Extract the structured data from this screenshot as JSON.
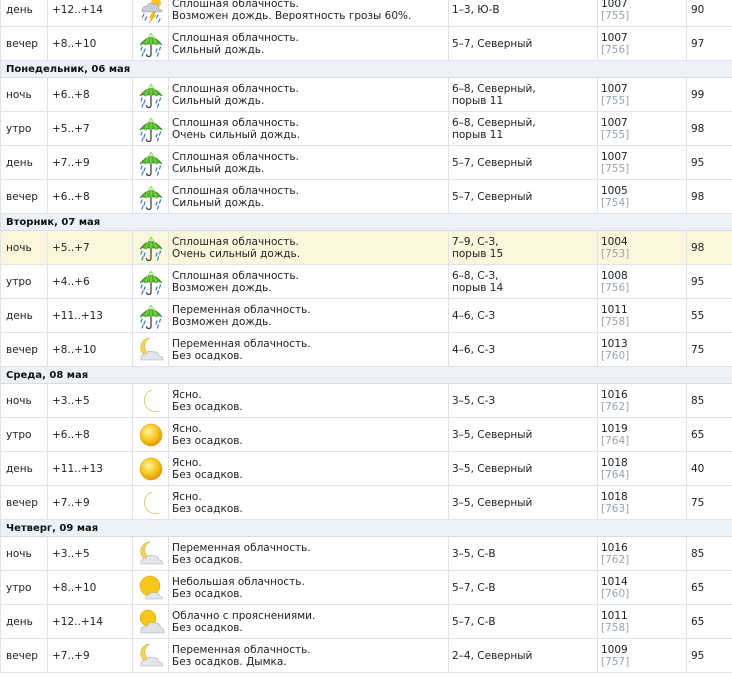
{
  "forecast": [
    {
      "rows": [
        {
          "part": "день",
          "temp": "+12..+14",
          "icon": "storm-rain-icon",
          "d1": "Сплошная облачность.",
          "d2": "Возможен дождь. Вероятность грозы 60%.",
          "w1": "1–3, Ю-В",
          "w2": "",
          "p": "1007",
          "mm": "[755]",
          "h": "90"
        },
        {
          "part": "вечер",
          "temp": "+8..+10",
          "icon": "umbrella-rain-icon",
          "d1": "Сплошная облачность.",
          "d2": "Сильный дождь.",
          "w1": "5–7, Северный",
          "w2": "",
          "p": "1007",
          "mm": "[756]",
          "h": "97"
        }
      ]
    },
    {
      "day": "Понедельник, 06 мая",
      "rows": [
        {
          "part": "ночь",
          "temp": "+6..+8",
          "icon": "umbrella-rain-icon",
          "d1": "Сплошная облачность.",
          "d2": "Сильный дождь.",
          "w1": "6–8, Северный,",
          "w2": "порыв 11",
          "p": "1007",
          "mm": "[755]",
          "h": "99"
        },
        {
          "part": "утро",
          "temp": "+5..+7",
          "icon": "umbrella-rain-icon",
          "d1": "Сплошная облачность.",
          "d2": "Очень сильный дождь.",
          "w1": "6–8, Северный,",
          "w2": "порыв 11",
          "p": "1007",
          "mm": "[755]",
          "h": "98"
        },
        {
          "part": "день",
          "temp": "+7..+9",
          "icon": "umbrella-rain-icon",
          "d1": "Сплошная облачность.",
          "d2": "Сильный дождь.",
          "w1": "5–7, Северный",
          "w2": "",
          "p": "1007",
          "mm": "[755]",
          "h": "95"
        },
        {
          "part": "вечер",
          "temp": "+6..+8",
          "icon": "umbrella-rain-icon",
          "d1": "Сплошная облачность.",
          "d2": "Сильный дождь.",
          "w1": "5–7, Северный",
          "w2": "",
          "p": "1005",
          "mm": "[754]",
          "h": "98"
        }
      ]
    },
    {
      "day": "Вторник, 07 мая",
      "rows": [
        {
          "part": "ночь",
          "temp": "+5..+7",
          "icon": "umbrella-rain-icon",
          "d1": "Сплошная облачность.",
          "d2": "Очень сильный дождь.",
          "w1": "7–9, С-З,",
          "w2": "порыв 15",
          "p": "1004",
          "mm": "[753]",
          "h": "98",
          "hl": true
        },
        {
          "part": "утро",
          "temp": "+4..+6",
          "icon": "umbrella-rain-icon",
          "d1": "Сплошная облачность.",
          "d2": "Возможен дождь.",
          "w1": "6–8, С-З,",
          "w2": "порыв 14",
          "p": "1008",
          "mm": "[756]",
          "h": "95"
        },
        {
          "part": "день",
          "temp": "+11..+13",
          "icon": "umbrella-rain-icon",
          "d1": "Переменная облачность.",
          "d2": "Возможен дождь.",
          "w1": "4–6, С-З",
          "w2": "",
          "p": "1011",
          "mm": "[758]",
          "h": "55"
        },
        {
          "part": "вечер",
          "temp": "+8..+10",
          "icon": "moon-cloud-icon",
          "d1": "Переменная облачность.",
          "d2": "Без осадков.",
          "w1": "4–6, С-З",
          "w2": "",
          "p": "1013",
          "mm": "[760]",
          "h": "75"
        }
      ]
    },
    {
      "day": "Среда, 08 мая",
      "rows": [
        {
          "part": "ночь",
          "temp": "+3..+5",
          "icon": "moon-icon",
          "d1": "Ясно.",
          "d2": "Без осадков.",
          "w1": "3–5, С-З",
          "w2": "",
          "p": "1016",
          "mm": "[762]",
          "h": "85"
        },
        {
          "part": "утро",
          "temp": "+6..+8",
          "icon": "sun-icon",
          "d1": "Ясно.",
          "d2": "Без осадков.",
          "w1": "3–5, Северный",
          "w2": "",
          "p": "1019",
          "mm": "[764]",
          "h": "65"
        },
        {
          "part": "день",
          "temp": "+11..+13",
          "icon": "sun-icon",
          "d1": "Ясно.",
          "d2": "Без осадков.",
          "w1": "3–5, Северный",
          "w2": "",
          "p": "1018",
          "mm": "[764]",
          "h": "40"
        },
        {
          "part": "вечер",
          "temp": "+7..+9",
          "icon": "moon-icon",
          "d1": "Ясно.",
          "d2": "Без осадков.",
          "w1": "3–5, Северный",
          "w2": "",
          "p": "1018",
          "mm": "[763]",
          "h": "75"
        }
      ]
    },
    {
      "day": "Четверг, 09 мая",
      "rows": [
        {
          "part": "ночь",
          "temp": "+3..+5",
          "icon": "moon-cloud-icon",
          "d1": "Переменная облачность.",
          "d2": "Без осадков.",
          "w1": "3–5, С-В",
          "w2": "",
          "p": "1016",
          "mm": "[762]",
          "h": "85"
        },
        {
          "part": "утро",
          "temp": "+8..+10",
          "icon": "sun-small-cloud-icon",
          "d1": "Небольшая облачность.",
          "d2": "Без осадков.",
          "w1": "5–7, С-В",
          "w2": "",
          "p": "1014",
          "mm": "[760]",
          "h": "65"
        },
        {
          "part": "день",
          "temp": "+12..+14",
          "icon": "sun-cloud-icon",
          "d1": "Облачно с прояснениями.",
          "d2": "Без осадков.",
          "w1": "5–7, С-В",
          "w2": "",
          "p": "1011",
          "mm": "[758]",
          "h": "65"
        },
        {
          "part": "вечер",
          "temp": "+7..+9",
          "icon": "moon-cloud-icon",
          "d1": "Переменная облачность.",
          "d2": "Без осадков. Дымка.",
          "w1": "2–4, Северный",
          "w2": "",
          "p": "1009",
          "mm": "[757]",
          "h": "95"
        }
      ]
    }
  ]
}
